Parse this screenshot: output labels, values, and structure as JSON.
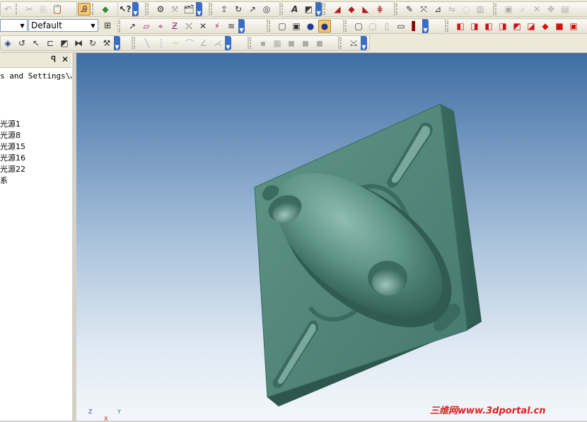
{
  "toolbar_row1": {
    "groups": [
      {
        "id": "g1",
        "icons": [
          "undo-icon",
          "cut-icon",
          "copy-icon",
          "paste-icon"
        ]
      },
      {
        "id": "g2",
        "icons": [
          "select-filter-icon",
          "display-icon"
        ]
      },
      {
        "id": "g3",
        "icons": [
          "help-icon"
        ]
      },
      {
        "id": "g4",
        "icons": [
          "part-icon",
          "tools-icon",
          "options-icon"
        ]
      },
      {
        "id": "g5",
        "icons": [
          "extrude-icon",
          "revolve-icon",
          "sweep-icon",
          "loft-icon"
        ]
      },
      {
        "id": "g6",
        "icons": [
          "text-icon",
          "decal-icon"
        ]
      },
      {
        "id": "g7",
        "icons": [
          "surface-icon",
          "shell-icon",
          "fillet-icon",
          "pattern-icon"
        ]
      },
      {
        "id": "g8",
        "icons": [
          "edit-icon",
          "transform-icon",
          "draft-icon",
          "mirror-icon",
          "hole-icon",
          "rib-icon"
        ]
      },
      {
        "id": "g9",
        "icons": [
          "view-icon",
          "zoom-icon",
          "rotate-icon",
          "pan-icon",
          "fit-icon"
        ]
      }
    ]
  },
  "toolbar_row2": {
    "style_combo_value": "",
    "layer_combo_value": "Default",
    "shading_modes": [
      "wireframe-icon",
      "hidden-line-icon",
      "shaded-icon",
      "shaded-edges-icon"
    ]
  },
  "panel": {
    "pin_glyph": "ꟼ",
    "close_glyph": "✕",
    "path": "s and Settings\\Ad",
    "items": [
      "光源1",
      "光源8",
      "光源15",
      "光源16",
      "光源22",
      "系"
    ]
  },
  "viewport": {
    "axis_x": "X",
    "axis_y": "Y",
    "axis_z": "Z"
  },
  "watermark": "三维网www.3dportal.cn",
  "colors": {
    "model": "#4e8276",
    "model_dark": "#2f5b51",
    "bg_top": "#3f6ea3",
    "bg_bottom": "#f3f7fb"
  }
}
